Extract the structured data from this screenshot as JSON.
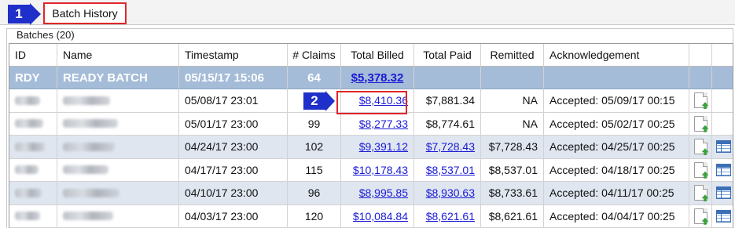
{
  "tab": {
    "label": "Batch History"
  },
  "steps": {
    "one": "1",
    "two": "2"
  },
  "group": {
    "legend": "Batches (20)"
  },
  "columns": [
    "ID",
    "Name",
    "Timestamp",
    "# Claims",
    "Total Billed",
    "Total Paid",
    "Remitted",
    "Acknowledgement"
  ],
  "ready_row": {
    "id": "RDY",
    "name": "READY BATCH",
    "timestamp": "05/15/17 15:06",
    "claims": "64",
    "total_billed": "$5,378.32"
  },
  "rows": [
    {
      "timestamp": "05/08/17 23:01",
      "claims": "",
      "total_billed": "$8,410.36",
      "total_paid": "$7,881.34",
      "remitted": "NA",
      "ack": "Accepted: 05/09/17 00:15",
      "paid_link": false,
      "table_icon": false
    },
    {
      "timestamp": "05/01/17 23:00",
      "claims": "99",
      "total_billed": "$8,277.33",
      "total_paid": "$8,774.61",
      "remitted": "NA",
      "ack": "Accepted: 05/02/17 00:25",
      "paid_link": false,
      "table_icon": false
    },
    {
      "timestamp": "04/24/17 23:00",
      "claims": "102",
      "total_billed": "$9,391.12",
      "total_paid": "$7,728.43",
      "remitted": "$7,728.43",
      "ack": "Accepted: 04/25/17 00:25",
      "paid_link": true,
      "table_icon": true
    },
    {
      "timestamp": "04/17/17 23:00",
      "claims": "115",
      "total_billed": "$10,178.43",
      "total_paid": "$8,537.01",
      "remitted": "$8,537.01",
      "ack": "Accepted: 04/18/17 00:25",
      "paid_link": true,
      "table_icon": true
    },
    {
      "timestamp": "04/10/17 23:00",
      "claims": "96",
      "total_billed": "$8,995.85",
      "total_paid": "$8,930.63",
      "remitted": "$8,733.61",
      "ack": "Accepted: 04/11/17 00:25",
      "paid_link": true,
      "table_icon": true
    },
    {
      "timestamp": "04/03/17 23:00",
      "claims": "120",
      "total_billed": "$10,084.84",
      "total_paid": "$8,621.61",
      "remitted": "$8,621.61",
      "ack": "Accepted: 04/04/17 00:25",
      "paid_link": true,
      "table_icon": true
    }
  ],
  "icons": {
    "document": "document-export-icon",
    "table": "table-view-icon"
  },
  "colors": {
    "ready_row": "#a5bcd8",
    "alt_row": "#dfe6f0",
    "link": "#1a1ad6",
    "highlight": "#e0262b",
    "step": "#1f2fc9"
  }
}
